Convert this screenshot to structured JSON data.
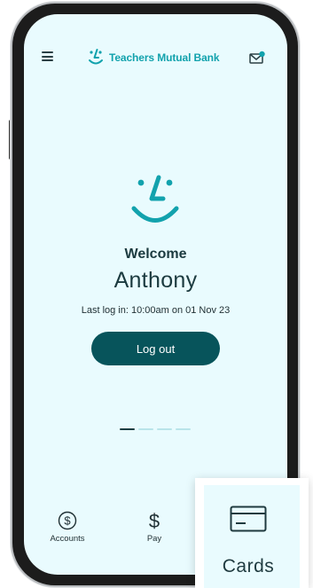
{
  "header": {
    "brand_name": "Teachers Mutual Bank",
    "menu_icon": "hamburger-menu-icon",
    "mail_icon": "mail-notification-icon"
  },
  "welcome": {
    "greeting": "Welcome",
    "user_name": "Anthony",
    "last_login": "Last log in: 10:00am on 01 Nov 23",
    "logout_label": "Log out"
  },
  "carousel": {
    "pages": 4,
    "active_index": 0
  },
  "bottom_nav": {
    "items": [
      {
        "label": "Accounts",
        "icon": "dollar-circle-icon"
      },
      {
        "label": "Pay",
        "icon": "dollar-sign-icon"
      }
    ]
  },
  "cards_callout": {
    "label": "Cards",
    "icon": "credit-card-icon"
  },
  "colors": {
    "brand_teal": "#12a2ad",
    "button_dark_teal": "#07545b",
    "screen_background": "#e9fbfe",
    "text_dark": "#1b3a3f"
  }
}
